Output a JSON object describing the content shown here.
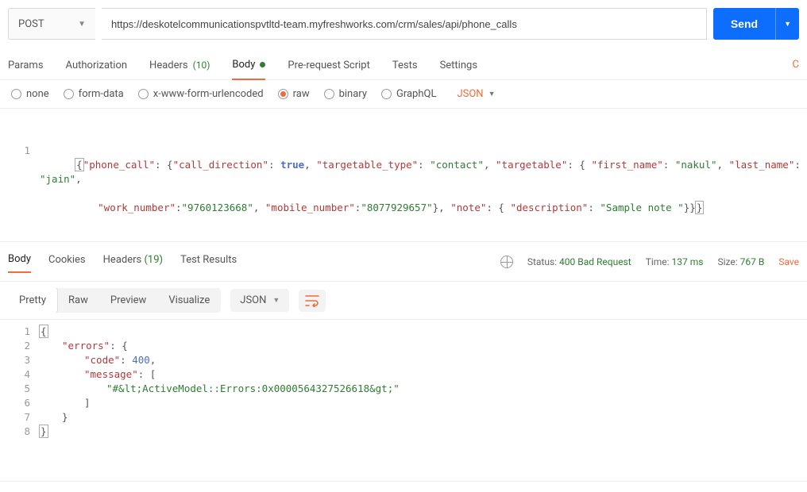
{
  "request": {
    "method": "POST",
    "url": "https://deskotelcommunicationspvtltd-team.myfreshworks.com/crm/sales/api/phone_calls",
    "send_label": "Send"
  },
  "maintabs": {
    "params": "Params",
    "authorization": "Authorization",
    "headers": "Headers",
    "headers_count": "(10)",
    "body": "Body",
    "prerequest": "Pre-request Script",
    "tests": "Tests",
    "settings": "Settings",
    "right_indicator": "C"
  },
  "body_types": {
    "none": "none",
    "formdata": "form-data",
    "xwww": "x-www-form-urlencoded",
    "raw": "raw",
    "binary": "binary",
    "graphql": "GraphQL",
    "lang": "JSON"
  },
  "req_body_line1_parts": {
    "open": "{",
    "k1": "\"phone_call\"",
    "c1": ": {",
    "k2": "\"call_direction\"",
    "c2": ": ",
    "v2": "true",
    "c2b": ", ",
    "k3": "\"targetable_type\"",
    "c3": ": ",
    "v3": "\"contact\"",
    "c3b": ", ",
    "k4": "\"targetable\"",
    "c4": ": { ",
    "k5": "\"first_name\"",
    "c5": ": ",
    "v5": "\"nakul\"",
    "c5b": ", ",
    "k6": "\"last_name\"",
    "c6": ": ",
    "v6": "\"jain\"",
    "c6b": ","
  },
  "req_body_line2_parts": {
    "k1": "\"work_number\"",
    "c1": ":",
    "v1": "\"9760123668\"",
    "c1b": ", ",
    "k2": "\"mobile_number\"",
    "c2": ":",
    "v2": "\"8077929657\"",
    "c2b": "}, ",
    "k3": "\"note\"",
    "c3": ": { ",
    "k4": "\"description\"",
    "c4": ": ",
    "v4": "\"Sample note \"",
    "c4b": "}}",
    "close": "}"
  },
  "resptabs": {
    "body": "Body",
    "cookies": "Cookies",
    "headers": "Headers",
    "headers_count": "(19)",
    "test_results": "Test Results"
  },
  "status": {
    "status_label": "Status:",
    "status_value": "400 Bad Request",
    "time_label": "Time:",
    "time_value": "137 ms",
    "size_label": "Size:",
    "size_value": "767 B",
    "save": "Save"
  },
  "viewbar": {
    "pretty": "Pretty",
    "raw": "Raw",
    "preview": "Preview",
    "visualize": "Visualize",
    "fmt": "JSON"
  },
  "response_lines": {
    "l1": "{",
    "l2_k": "\"errors\"",
    "l2_r": ": {",
    "l3_k": "\"code\"",
    "l3_c": ": ",
    "l3_v": "400",
    "l3_e": ",",
    "l4_k": "\"message\"",
    "l4_r": ": [",
    "l5_v": "\"#&lt;ActiveModel::Errors:0x0000564327526618&gt;\"",
    "l6": "]",
    "l7": "}",
    "l8": "}"
  },
  "gutter": {
    "g1": "1",
    "g2": "2",
    "g3": "3",
    "g4": "4",
    "g5": "5",
    "g6": "6",
    "g7": "7",
    "g8": "8"
  }
}
